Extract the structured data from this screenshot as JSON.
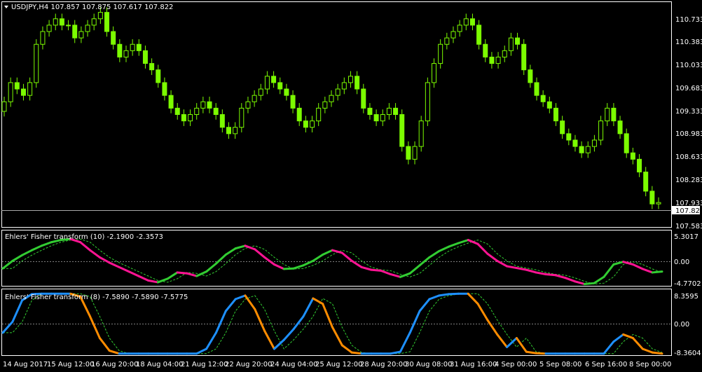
{
  "colors": {
    "background": "#000000",
    "foreground": "#ffffff",
    "candle": "#7CFC00",
    "fisher_up": "#32CD32",
    "fisher_down": "#FF1493",
    "fisher2_up": "#1E90FF",
    "fisher2_down": "#FF8C00",
    "signal": "#32CD32",
    "grid_zero": "#808080"
  },
  "main": {
    "symbol_header": "USDJPY,H4  107.857 107.875 107.617 107.822",
    "price_label": "107.822",
    "price_ticks": [
      "110.733",
      "110.383",
      "110.033",
      "109.683",
      "109.333",
      "108.983",
      "108.633",
      "108.283",
      "107.933",
      "107.583"
    ]
  },
  "ind1": {
    "title": "Ehlers' Fisher transform (10) -2.1900 -2.3573",
    "ticks": [
      "5.3017",
      "0.00",
      "-4.7702"
    ]
  },
  "ind2": {
    "title": "Ehlers' Fisher transform (8) -7.5890 -7.5890 -7.5775",
    "ticks": [
      "8.3595",
      "0.00",
      "-8.3604"
    ]
  },
  "time_axis": [
    "14 Aug 2017",
    "15 Aug 12:00",
    "16 Aug 20:00",
    "18 Aug 04:00",
    "21 Aug 12:00",
    "22 Aug 20:00",
    "24 Aug 04:00",
    "25 Aug 12:00",
    "28 Aug 20:00",
    "30 Aug 08:00",
    "31 Aug 16:00",
    "4 Sep 00:00",
    "5 Sep 08:00",
    "6 Sep 16:00",
    "8 Sep 00:00"
  ],
  "chart_data": [
    {
      "type": "candlestick",
      "title": "USDJPY,H4",
      "ohlc_last": [
        107.857,
        107.875,
        107.617,
        107.822
      ],
      "ylim": [
        107.45,
        110.95
      ],
      "close": [
        109.4,
        109.7,
        109.6,
        109.5,
        109.7,
        110.3,
        110.5,
        110.6,
        110.7,
        110.6,
        110.6,
        110.4,
        110.5,
        110.6,
        110.7,
        110.8,
        110.5,
        110.3,
        110.1,
        110.2,
        110.3,
        110.2,
        110.0,
        109.9,
        109.7,
        109.5,
        109.3,
        109.2,
        109.1,
        109.2,
        109.3,
        109.4,
        109.3,
        109.2,
        109.0,
        108.9,
        109.0,
        109.3,
        109.4,
        109.5,
        109.6,
        109.8,
        109.7,
        109.6,
        109.5,
        109.3,
        109.1,
        109.0,
        109.1,
        109.3,
        109.4,
        109.5,
        109.6,
        109.7,
        109.8,
        109.6,
        109.3,
        109.2,
        109.1,
        109.2,
        109.3,
        109.2,
        108.7,
        108.5,
        108.7,
        109.1,
        109.7,
        110.0,
        110.3,
        110.4,
        110.5,
        110.6,
        110.7,
        110.6,
        110.3,
        110.1,
        110.0,
        110.1,
        110.2,
        110.4,
        110.3,
        109.9,
        109.7,
        109.5,
        109.4,
        109.3,
        109.1,
        108.9,
        108.8,
        108.7,
        108.6,
        108.7,
        108.8,
        109.1,
        109.3,
        109.1,
        108.9,
        108.6,
        108.5,
        108.3,
        108.0,
        107.8,
        107.822
      ]
    },
    {
      "type": "line",
      "title": "Ehlers' Fisher transform (10)",
      "ylim": [
        -4.7702,
        5.3017
      ],
      "series": [
        {
          "values": [
            -1.5,
            0.2,
            1.5,
            2.6,
            3.6,
            4.4,
            4.9,
            5.1,
            4.4,
            2.6,
            1.0,
            -0.2,
            -1.2,
            -2.2,
            -3.2,
            -4.2,
            -4.6,
            -3.8,
            -2.4,
            -2.6,
            -3.2,
            -2.2,
            -0.4,
            1.6,
            3.0,
            3.6,
            2.8,
            1.0,
            -0.6,
            -1.6,
            -1.5,
            -0.8,
            0.2,
            1.6,
            2.6,
            2.0,
            0.2,
            -1.2,
            -1.8,
            -2.0,
            -2.8,
            -3.4,
            -2.6,
            -0.8,
            1.0,
            2.4,
            3.4,
            4.2,
            4.9,
            4.0,
            1.8,
            0.2,
            -1.0,
            -1.4,
            -1.8,
            -2.4,
            -2.8,
            -3.0,
            -3.6,
            -4.4,
            -5.0,
            -4.8,
            -3.4,
            -0.6,
            0.0,
            -0.6,
            -1.6,
            -2.4,
            -2.2
          ]
        }
      ]
    },
    {
      "type": "line",
      "title": "Ehlers' Fisher transform (8)",
      "ylim": [
        -8.3604,
        8.3595
      ],
      "series": [
        {
          "values": [
            -2.5,
            0.5,
            6.5,
            8.2,
            8.3,
            8.3,
            8.3,
            8.3,
            7.5,
            2.0,
            -4.0,
            -7.5,
            -8.3,
            -8.3,
            -8.3,
            -8.3,
            -8.3,
            -8.3,
            -8.3,
            -8.3,
            -8.3,
            -7.0,
            -2.5,
            3.5,
            6.8,
            7.8,
            4.0,
            -2.0,
            -7.0,
            -4.5,
            -1.5,
            2.0,
            7.0,
            5.5,
            -1.0,
            -6.0,
            -8.0,
            -8.3,
            -8.3,
            -8.3,
            -8.3,
            -7.8,
            -2.5,
            3.5,
            6.8,
            7.8,
            8.2,
            8.3,
            8.3,
            5.5,
            1.0,
            -3.0,
            -6.5,
            -4.0,
            -7.8,
            -8.2,
            -8.3,
            -8.3,
            -8.3,
            -8.3,
            -8.3,
            -8.3,
            -8.3,
            -5.0,
            -3.0,
            -4.0,
            -7.0,
            -8.0,
            -8.3
          ]
        }
      ]
    }
  ]
}
